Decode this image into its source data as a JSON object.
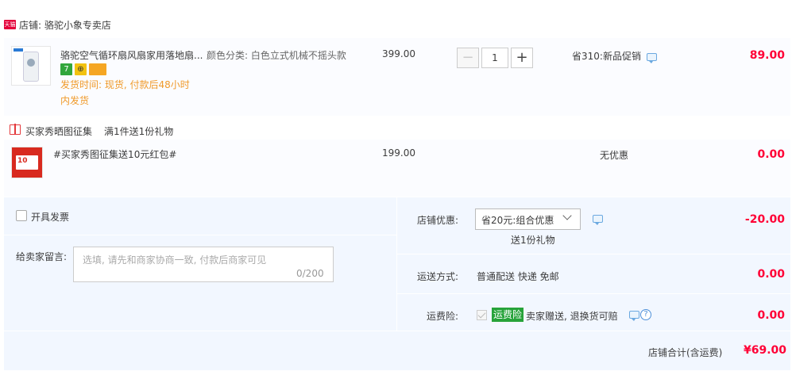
{
  "shop": {
    "badge": "天猫",
    "label": "店铺: 骆驼小象专卖店"
  },
  "item1": {
    "name": "骆驼空气循环扇风扇家用落地扇...",
    "sku": "颜色分类: 白色立式机械不摇头款",
    "price": "399.00",
    "quantity": "1",
    "minus": "−",
    "plus": "+",
    "promo": "省310:新品促销",
    "amount": "89.00",
    "badges": [
      "7",
      "⊕",
      ""
    ],
    "ship_time_line1": "发货时间: 现货, 付款后48小时",
    "ship_time_line2": "内发货"
  },
  "gift": {
    "title": "买家秀晒图征集",
    "subtitle": "满1件送1份礼物"
  },
  "item2": {
    "name": "#买家秀图征集送10元红包#",
    "price": "199.00",
    "promo": "无优惠",
    "amount": "0.00"
  },
  "summary": {
    "invoice_label": "开具发票",
    "message_label": "给卖家留言:",
    "message_placeholder": "选填, 请先和商家协商一致, 付款后商家可见",
    "message_count": "0/200",
    "shop_discount_label": "店铺优惠:",
    "shop_discount_selected": "省20元:组合优惠",
    "shop_discount_gift": "送1份礼物",
    "shop_discount_amount": "-20.00",
    "shipping_label": "运送方式:",
    "shipping_value": "普通配送 快递 免邮",
    "shipping_amount": "0.00",
    "insurance_label": "运费险:",
    "insurance_tag": "运费险",
    "insurance_text": "卖家赠送, 退换货可赔",
    "insurance_amount": "0.00",
    "total_label": "店铺合计(含运费)",
    "total_value": "¥69.00"
  },
  "colors": {
    "accent": "#ff0036",
    "orange": "#f09a2a",
    "summary_bg": "#f2f7ff",
    "insurance_green": "#27a33a"
  }
}
